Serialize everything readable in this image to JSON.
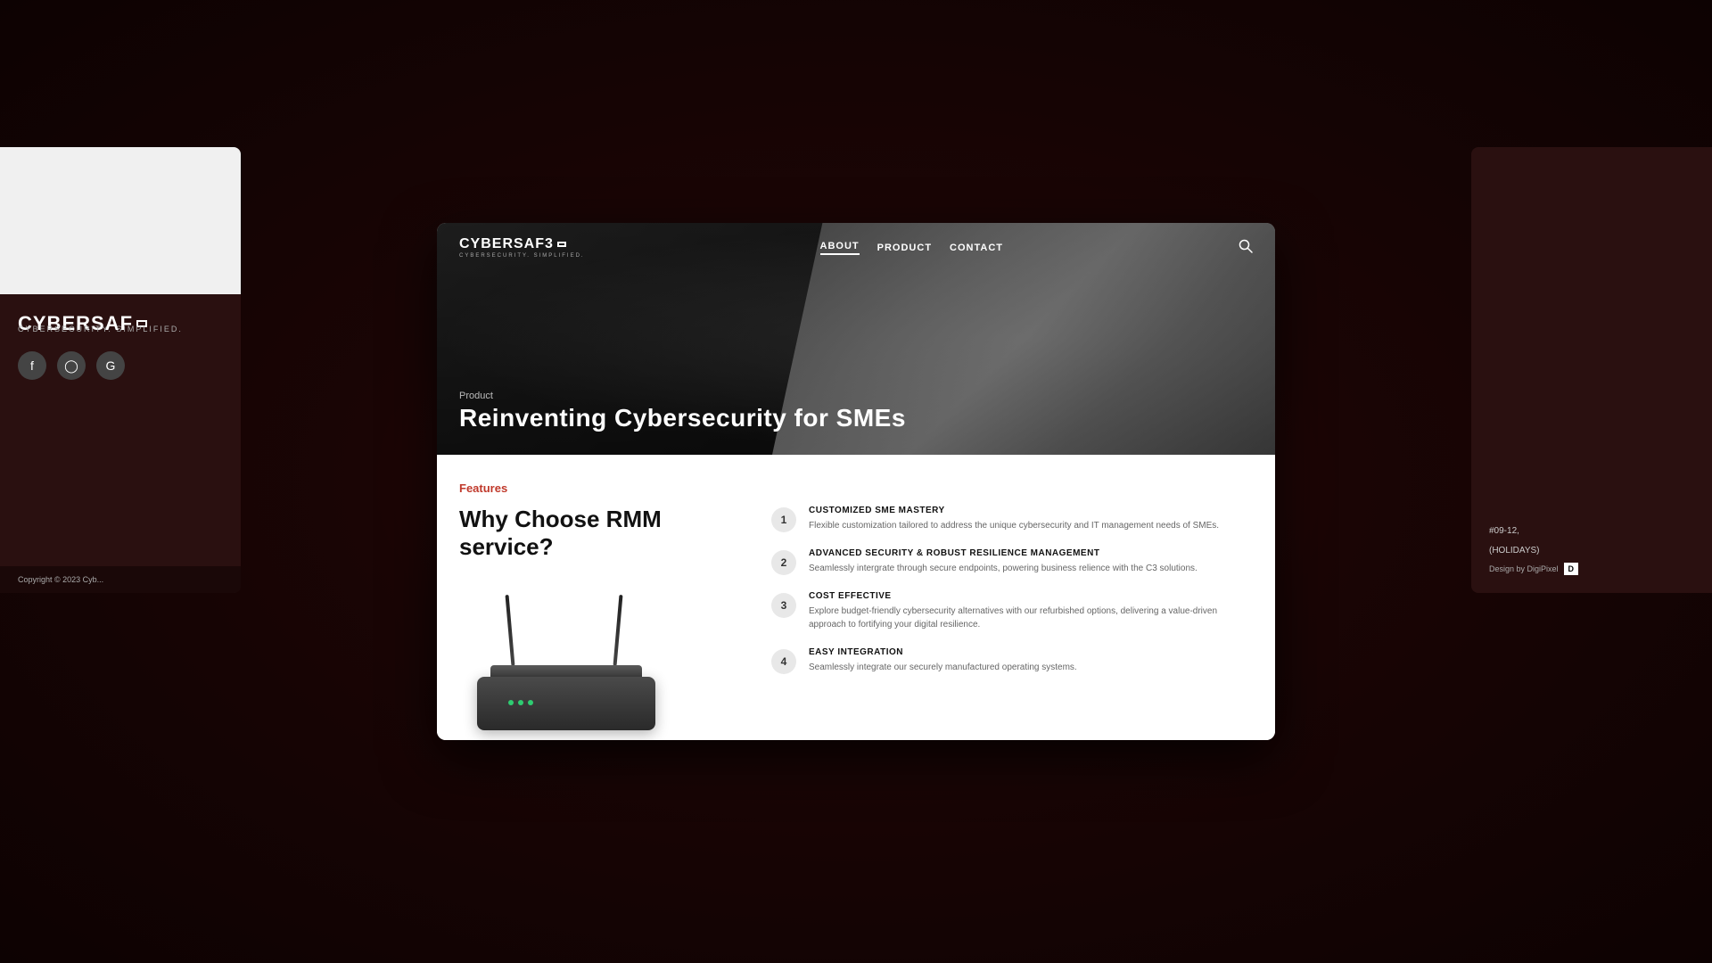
{
  "background": {
    "color": "#1a0505"
  },
  "navbar": {
    "logo_text": "CYBERSAF3",
    "logo_sub": "CYBERSECURITY. SIMPLIFIED.",
    "links": [
      {
        "label": "ABOUT",
        "active": false
      },
      {
        "label": "PRODUCT",
        "active": false
      },
      {
        "label": "CONTACT",
        "active": false
      }
    ]
  },
  "hero": {
    "breadcrumb": "Product",
    "title": "Reinventing Cybersecurity for SMEs"
  },
  "content": {
    "features_label": "Features",
    "section_title": "Why Choose RMM service?",
    "features": [
      {
        "number": "1",
        "title": "CUSTOMIZED SME MASTERY",
        "description": "Flexible customization tailored to address the unique cybersecurity and IT management needs of SMEs."
      },
      {
        "number": "2",
        "title": "ADVANCED SECURITY & ROBUST RESILIENCE MANAGEMENT",
        "description": "Seamlessly intergrate through secure endpoints, powering business relience with the C3 solutions."
      },
      {
        "number": "3",
        "title": "COST EFFECTIVE",
        "description": "Explore budget-friendly cybersecurity alternatives with our refurbished options, delivering a value-driven approach to fortifying your digital resilience."
      },
      {
        "number": "4",
        "title": "EASY INTEGRATION",
        "description": "Seamlessly integrate our securely manufactured operating systems."
      }
    ]
  },
  "sidebar_left": {
    "logo_text": "CYBERSAF",
    "logo_sub": "CYBERSECURITY. SIMPLIFIED.",
    "social": [
      "f",
      "ig",
      "G"
    ],
    "copyright": "Copyright © 2023 Cyb..."
  },
  "sidebar_right": {
    "address": "#09-12,",
    "hours": "(HOLIDAYS)",
    "design_label": "Design by DigiPixel"
  }
}
